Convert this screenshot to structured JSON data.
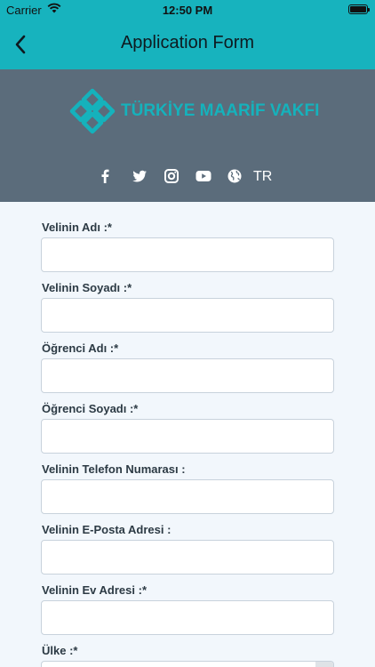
{
  "status_bar": {
    "carrier": "Carrier",
    "time": "12:50 PM"
  },
  "nav": {
    "title": "Application Form"
  },
  "banner": {
    "logo_text": "TÜRKİYE MAARİF VAKFI",
    "social_icons": [
      "facebook-icon",
      "twitter-icon",
      "instagram-icon",
      "youtube-icon",
      "globe-icon"
    ],
    "language": "TR"
  },
  "form": {
    "fields": [
      {
        "label": "Velinin Adı :*",
        "value": ""
      },
      {
        "label": "Velinin Soyadı :*",
        "value": ""
      },
      {
        "label": "Öğrenci Adı :*",
        "value": ""
      },
      {
        "label": "Öğrenci Soyadı :*",
        "value": ""
      },
      {
        "label": "Velinin Telefon Numarası :",
        "value": ""
      },
      {
        "label": "Velinin E-Posta Adresi :",
        "value": ""
      },
      {
        "label": "Velinin Ev Adresi :*",
        "value": ""
      },
      {
        "label": "Ülke :*",
        "value": ""
      }
    ]
  },
  "colors": {
    "header": "#17b3be",
    "banner": "#5b6c7b",
    "brand": "#15b2bc",
    "background": "#f2f7fc"
  }
}
